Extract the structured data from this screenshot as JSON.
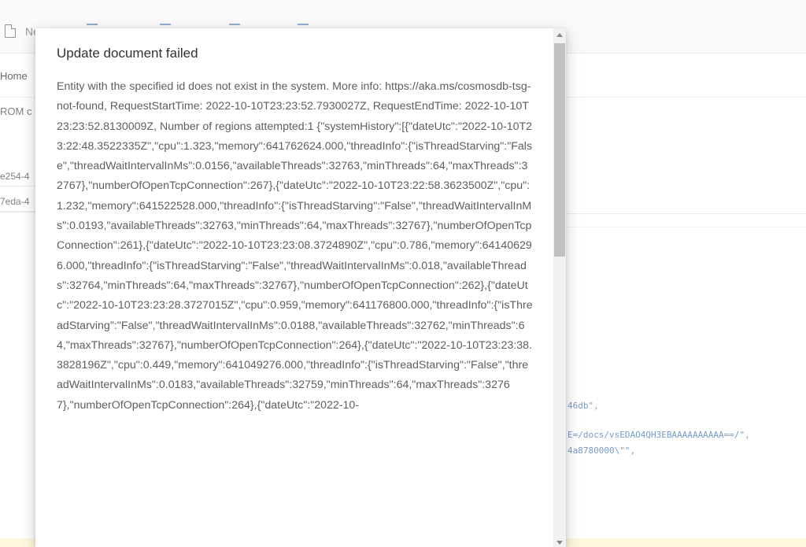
{
  "background": {
    "toolbar": {
      "new_label": "Ne"
    },
    "tabs": {
      "home": "Home"
    },
    "query": {
      "snippet": "ROM c"
    },
    "id_rows": [
      "e254-4",
      "7eda-4"
    ],
    "code_fragments": [
      "46db\",",
      "E=/docs/vsEDAO4QH3EBAAAAAAAAAA==/\",",
      "4a8780000\\\"\","
    ]
  },
  "dialog": {
    "title": "Update document failed",
    "message": "Entity with the specified id does not exist in the system. More info: https://aka.ms/cosmosdb-tsg-not-found, RequestStartTime: 2022-10-10T23:23:52.7930027Z, RequestEndTime: 2022-10-10T23:23:52.8130009Z, Number of regions attempted:1 {\"systemHistory\":[{\"dateUtc\":\"2022-10-10T23:22:48.3522335Z\",\"cpu\":1.323,\"memory\":641762624.000,\"threadInfo\":{\"isThreadStarving\":\"False\",\"threadWaitIntervalInMs\":0.0156,\"availableThreads\":32763,\"minThreads\":64,\"maxThreads\":32767},\"numberOfOpenTcpConnection\":267},{\"dateUtc\":\"2022-10-10T23:22:58.3623500Z\",\"cpu\":1.232,\"memory\":641522528.000,\"threadInfo\":{\"isThreadStarving\":\"False\",\"threadWaitIntervalInMs\":0.0193,\"availableThreads\":32763,\"minThreads\":64,\"maxThreads\":32767},\"numberOfOpenTcpConnection\":261},{\"dateUtc\":\"2022-10-10T23:23:08.3724890Z\",\"cpu\":0.786,\"memory\":641406296.000,\"threadInfo\":{\"isThreadStarving\":\"False\",\"threadWaitIntervalInMs\":0.018,\"availableThreads\":32764,\"minThreads\":64,\"maxThreads\":32767},\"numberOfOpenTcpConnection\":262},{\"dateUtc\":\"2022-10-10T23:23:28.3727015Z\",\"cpu\":0.959,\"memory\":641176800.000,\"threadInfo\":{\"isThreadStarving\":\"False\",\"threadWaitIntervalInMs\":0.0188,\"availableThreads\":32762,\"minThreads\":64,\"maxThreads\":32767},\"numberOfOpenTcpConnection\":264},{\"dateUtc\":\"2022-10-10T23:23:38.3828196Z\",\"cpu\":0.449,\"memory\":641049276.000,\"threadInfo\":{\"isThreadStarving\":\"False\",\"threadWaitIntervalInMs\":0.0183,\"availableThreads\":32759,\"minThreads\":64,\"maxThreads\":32767},\"numberOfOpenTcpConnection\":264},{\"dateUtc\":\"2022-10-"
  },
  "colors": {
    "dialog_title": "#323130",
    "dialog_body": "#605e5c",
    "code_blue": "#4a78b8",
    "scroll_thumb": "#c1c1c1"
  }
}
